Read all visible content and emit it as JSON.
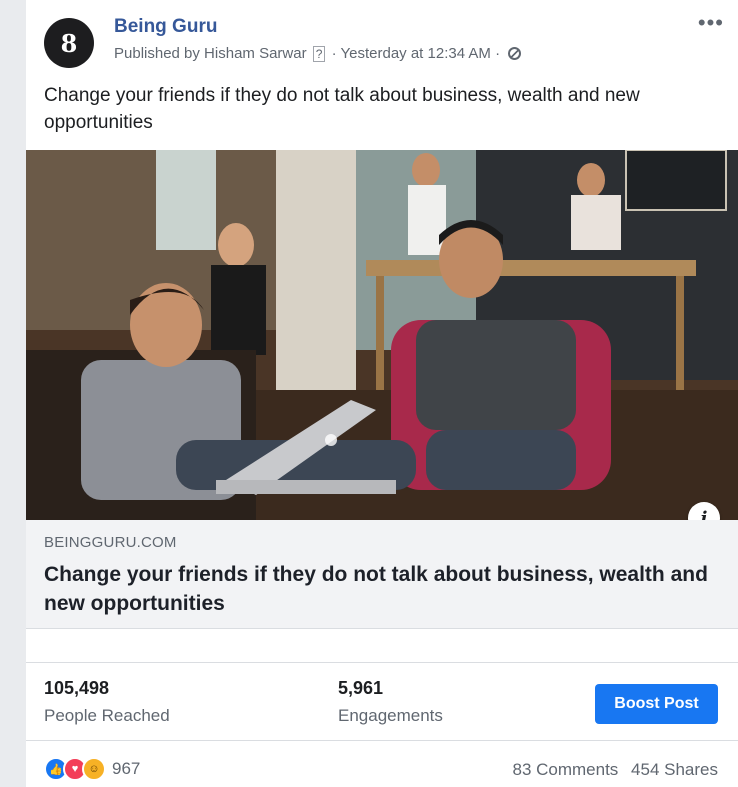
{
  "post": {
    "page_name": "Being Guru",
    "avatar_text": "8",
    "published_by": "Published by Hisham Sarwar",
    "help_marker": "?",
    "time": "· Yesterday at 12:34 AM ·",
    "more": "•••",
    "text": "Change your friends if they do not talk about business, wealth and new opportunities"
  },
  "link": {
    "domain": "BEINGGURU.COM",
    "title": "Change your friends if they do not talk about business, wealth and new opportunities",
    "info": "i"
  },
  "stats": {
    "reached_value": "105,498",
    "reached_label": "People Reached",
    "engagements_value": "5,961",
    "engagements_label": "Engagements",
    "boost_label": "Boost Post"
  },
  "footer": {
    "reaction_count": "967",
    "comments": "83 Comments",
    "shares": "454 Shares"
  },
  "colors": {
    "accent": "#1877f2",
    "page_name": "#365899",
    "secondary_text": "#606770"
  }
}
